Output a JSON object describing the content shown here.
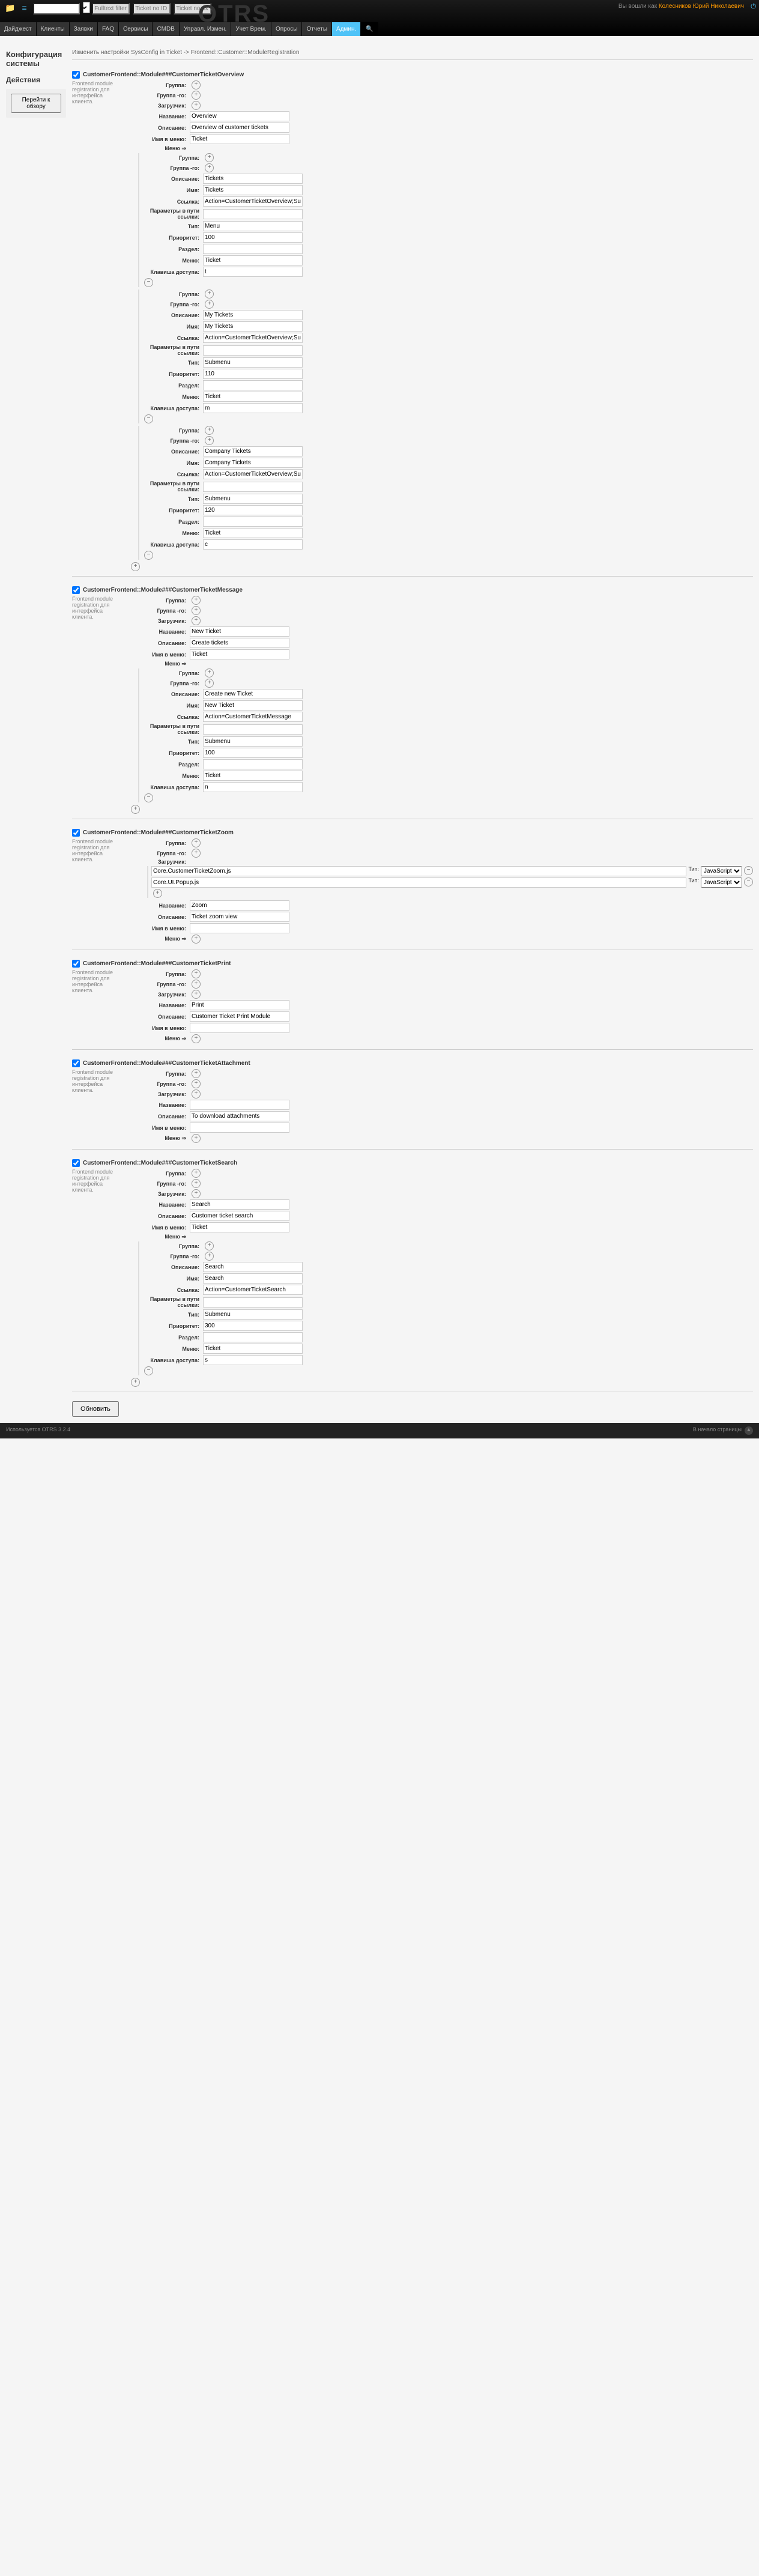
{
  "nav": [
    "Дайджест",
    "Клиенты",
    "Заявки",
    "FAQ",
    "Сервисы",
    "CMDB",
    "Управл. Измен.",
    "Учет Врем.",
    "Опросы",
    "Отчеты",
    "Админ."
  ],
  "user": {
    "pre": "Вы вошли как",
    "name": "Колесников Юрий Николаевич"
  },
  "side": {
    "title": "Действия",
    "btn": "Перейти к обзору"
  },
  "page_title": "Конфигурация системы",
  "crumb": "Изменить настройки SysConfig in Ticket -> Frontend::Customer::ModuleRegistration",
  "s1": {
    "title": "CustomerFrontend::Module###CustomerTicketOverview",
    "desc": "Frontend module registration для интерфейса клиента.",
    "lbl": {
      "grp": "Группа:",
      "grpro": "Группа -ro:",
      "load": "Загрузчик:",
      "name": "Название:",
      "desc": "Описание:",
      "nav": "Имя в меню:",
      "menu": "Меню ⇒",
      "descr": "Описание:",
      "nm": "Имя:",
      "link": "Ссылка:",
      "lopt": "Параметры в пути ссылки:",
      "type": "Тип:",
      "prio": "Приоритет:",
      "sect": "Раздел:",
      "mn": "Меню:",
      "key": "Клавиша доступа:"
    },
    "v": {
      "name": "Overview",
      "desc": "Overview of customer tickets",
      "nav": "Ticket",
      "m1": {
        "desc": "Tickets",
        "nm": "Tickets",
        "link": "Action=CustomerTicketOverview;Subaction=MyTickets",
        "type": "Menu",
        "prio": "100",
        "mn": "Ticket",
        "key": "t"
      },
      "m2": {
        "desc": "My Tickets",
        "nm": "My Tickets",
        "link": "Action=CustomerTicketOverview;Subaction=MyTickets",
        "type": "Submenu",
        "prio": "110",
        "mn": "Ticket",
        "key": "m"
      },
      "m3": {
        "desc": "Company Tickets",
        "nm": "Company Tickets",
        "link": "Action=CustomerTicketOverview;Subaction=CompanyTickets",
        "type": "Submenu",
        "prio": "120",
        "mn": "Ticket",
        "key": "c"
      }
    }
  },
  "s2": {
    "title": "CustomerFrontend::Module###CustomerTicketMessage",
    "desc": "Frontend module registration для интерфейса клиента.",
    "v": {
      "name": "New Ticket",
      "desc": "Create tickets",
      "nav": "Ticket",
      "m1": {
        "desc": "Create new Ticket",
        "nm": "New Ticket",
        "link": "Action=CustomerTicketMessage",
        "type": "Submenu",
        "prio": "100",
        "mn": "Ticket",
        "key": "n"
      }
    }
  },
  "s3": {
    "title": "CustomerFrontend::Module###CustomerTicketZoom",
    "desc": "Frontend module registration для интерфейса клиента.",
    "v": {
      "l1": "Core.CustomerTicketZoom.js",
      "l2": "Core.UI.Popup.js",
      "name": "Zoom",
      "desc": "Ticket zoom view"
    },
    "jslabel": "Тип:",
    "js": "JavaScript"
  },
  "s4": {
    "title": "CustomerFrontend::Module###CustomerTicketPrint",
    "desc": "Frontend module registration для интерфейса клиента.",
    "v": {
      "name": "Print",
      "desc": "Customer Ticket Print Module"
    }
  },
  "s5": {
    "title": "CustomerFrontend::Module###CustomerTicketAttachment",
    "desc": "Frontend module registration для интерфейса клиента.",
    "v": {
      "desc": "To download attachments"
    }
  },
  "s6": {
    "title": "CustomerFrontend::Module###CustomerTicketSearch",
    "desc": "Frontend module registration для интерфейса клиента.",
    "v": {
      "name": "Search",
      "desc": "Customer ticket search",
      "nav": "Ticket",
      "m1": {
        "desc": "Search",
        "nm": "Search",
        "link": "Action=CustomerTicketSearch",
        "type": "Submenu",
        "prio": "300",
        "mn": "Ticket",
        "key": "s"
      }
    }
  },
  "submit": "Обновить",
  "foot": {
    "l": "Используется OTRS 3.2.4",
    "r": "В начало страницы"
  },
  "ph": {
    "ft": "Fulltext filter",
    "tn": "Ticket no ID",
    "tn2": "Ticket no ex"
  }
}
